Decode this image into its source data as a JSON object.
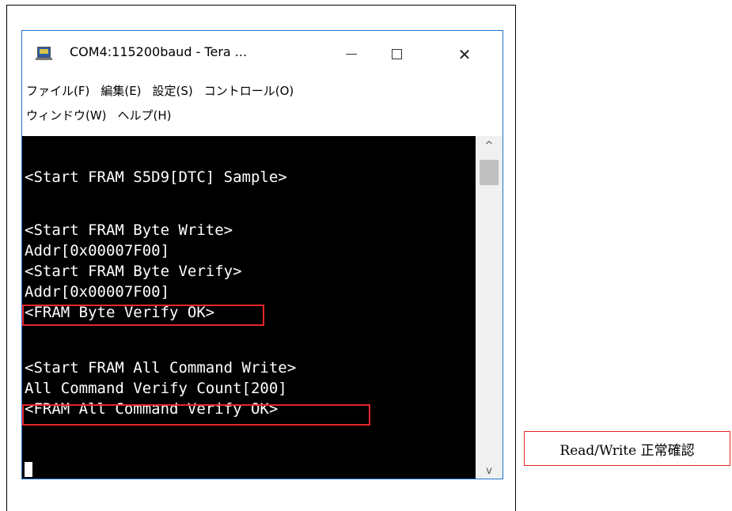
{
  "window": {
    "title": "COM4:115200baud - Tera ...",
    "minimize": "",
    "maximize": "",
    "close": "✕"
  },
  "menu": {
    "row1": [
      "ファイル(F)",
      "編集(E)",
      "設定(S)",
      "コントロール(O)"
    ],
    "row2": [
      "ウィンドウ(W)",
      "ヘルプ(H)"
    ]
  },
  "terminal": {
    "lines": [
      "<Start FRAM S5D9[DTC] Sample>",
      "",
      "<Start FRAM Byte Write>",
      "Addr[0x00007F00]",
      "<Start FRAM Byte Verify>",
      "Addr[0x00007F00]",
      "<FRAM Byte Verify OK>",
      "",
      "<Start FRAM All Command Write>",
      "All Command Verify Count[200]",
      "<FRAM All Command Verify OK>"
    ]
  },
  "scrollbar": {
    "up": "^",
    "down": "v"
  },
  "annotation": {
    "label": "Read/Write 正常確認"
  },
  "colors": {
    "highlight": "#e8262a",
    "terminal_bg": "#000000",
    "terminal_fg": "#ffffff"
  }
}
